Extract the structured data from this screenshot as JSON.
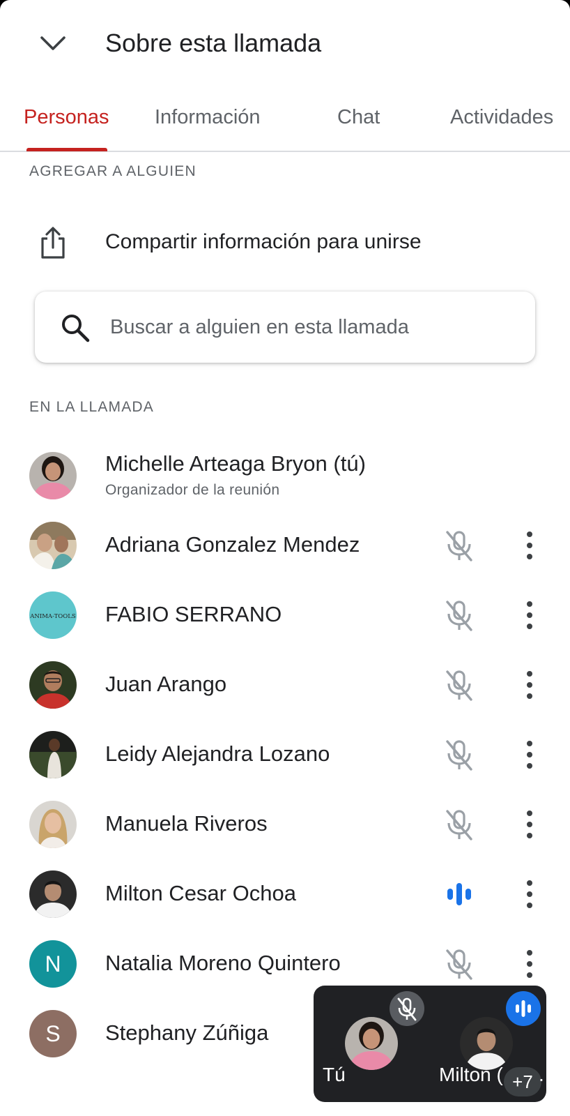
{
  "header": {
    "title": "Sobre esta llamada"
  },
  "tabs": [
    {
      "label": "Personas",
      "active": true
    },
    {
      "label": "Información",
      "active": false
    },
    {
      "label": "Chat",
      "active": false
    },
    {
      "label": "Actividades",
      "active": false
    }
  ],
  "add_section": {
    "heading": "AGREGAR A ALGUIEN",
    "share_label": "Compartir información para unirse"
  },
  "search": {
    "placeholder": "Buscar a alguien en esta llamada",
    "value": ""
  },
  "in_call": {
    "heading": "EN LA LLAMADA",
    "participants": [
      {
        "name": "Michelle Arteaga Bryon (tú)",
        "subtitle": "Organizador de la reunión",
        "mic": "none",
        "avatar": "photo"
      },
      {
        "name": "Adriana Gonzalez Mendez",
        "mic": "muted",
        "avatar": "photo"
      },
      {
        "name": "FABIO SERRANO",
        "mic": "muted",
        "avatar": "logo",
        "avatar_text": "ANIMA-TOOLS"
      },
      {
        "name": "Juan Arango",
        "mic": "muted",
        "avatar": "photo"
      },
      {
        "name": "Leidy Alejandra Lozano",
        "mic": "muted",
        "avatar": "photo"
      },
      {
        "name": "Manuela Riveros",
        "mic": "muted",
        "avatar": "photo"
      },
      {
        "name": "Milton Cesar Ochoa",
        "mic": "speaking",
        "avatar": "photo"
      },
      {
        "name": "Natalia Moreno Quintero",
        "mic": "muted",
        "avatar": "initial",
        "initial": "N"
      },
      {
        "name": "Stephany Zúñiga",
        "mic": "hidden",
        "avatar": "initial",
        "initial": "S"
      }
    ]
  },
  "pip": {
    "self_label": "Tú",
    "speaker_label": "Milton (",
    "overflow_count": "+7",
    "overflow_suffix": "."
  },
  "colors": {
    "accent_red": "#c5221f",
    "speaking_blue": "#1a73e8",
    "muted_gray": "#9aa0a6",
    "avatar_teal": "#12939a",
    "avatar_brown": "#8d6e63",
    "logo_bg": "#5ec6cc"
  },
  "icons": {
    "collapse": "chevron-down-icon",
    "share": "share-icon",
    "search": "search-icon",
    "muted": "mic-off-icon",
    "speaking": "audio-bars-icon",
    "menu": "more-vert-icon"
  }
}
